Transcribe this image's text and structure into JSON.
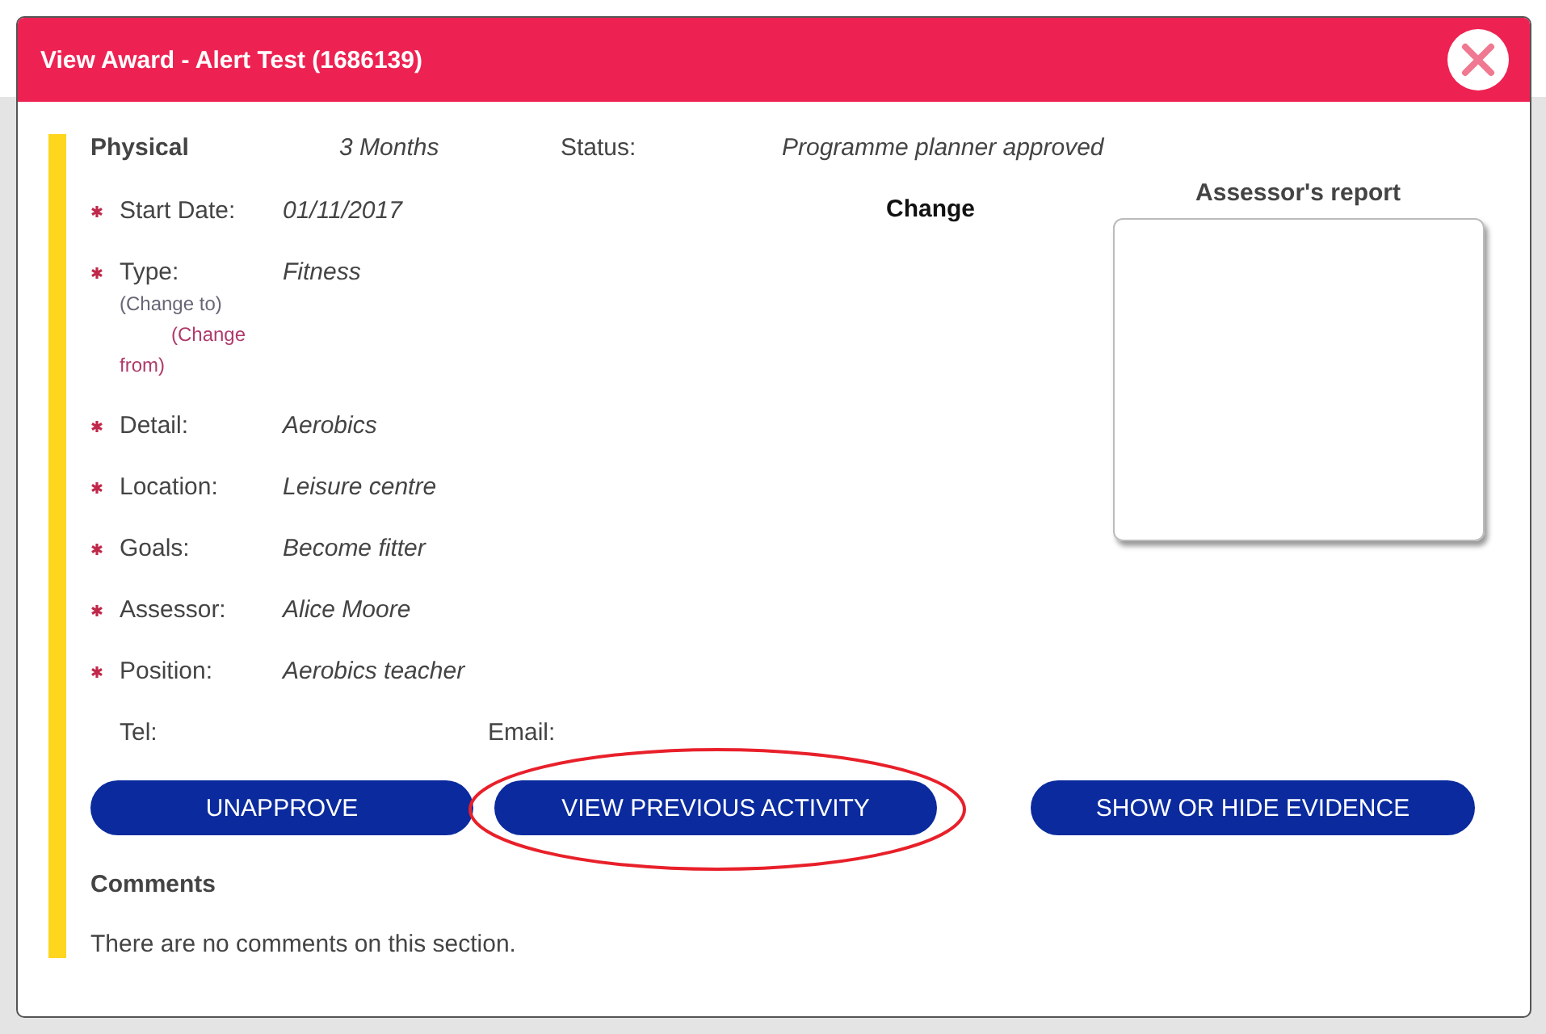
{
  "dialog": {
    "title": "View Award - Alert Test (1686139)",
    "section": "Physical",
    "duration": "3 Months",
    "status_label": "Status:",
    "status": "Programme planner approved",
    "fields": [
      {
        "label": "Start Date:",
        "value": "01/11/2017",
        "required": true
      },
      {
        "label": "Type:",
        "value": "Fitness",
        "required": true,
        "notes": [
          {
            "text": "(Change to)",
            "kind": "to"
          },
          {
            "text": "(Change from)",
            "kind": "from"
          }
        ]
      },
      {
        "label": "Detail:",
        "value": "Aerobics",
        "required": true
      },
      {
        "label": "Location:",
        "value": "Leisure centre",
        "required": true
      },
      {
        "label": "Goals:",
        "value": "Become fitter",
        "required": true
      },
      {
        "label": "Assessor:",
        "value": "Alice Moore",
        "required": true
      },
      {
        "label": "Position:",
        "value": "Aerobics teacher",
        "required": true
      }
    ],
    "contact": [
      {
        "label": "Tel:"
      },
      {
        "label": "Email:"
      }
    ],
    "change_heading": "Change",
    "report": {
      "title": "Assessor's report"
    },
    "buttons": [
      {
        "label": "UNAPPROVE",
        "highlighted": false
      },
      {
        "label": "VIEW PREVIOUS ACTIVITY",
        "highlighted": true
      },
      {
        "label": "SHOW OR HIDE EVIDENCE",
        "highlighted": false
      }
    ],
    "comments": {
      "title": "Comments",
      "text": "There are no comments on this section."
    }
  }
}
